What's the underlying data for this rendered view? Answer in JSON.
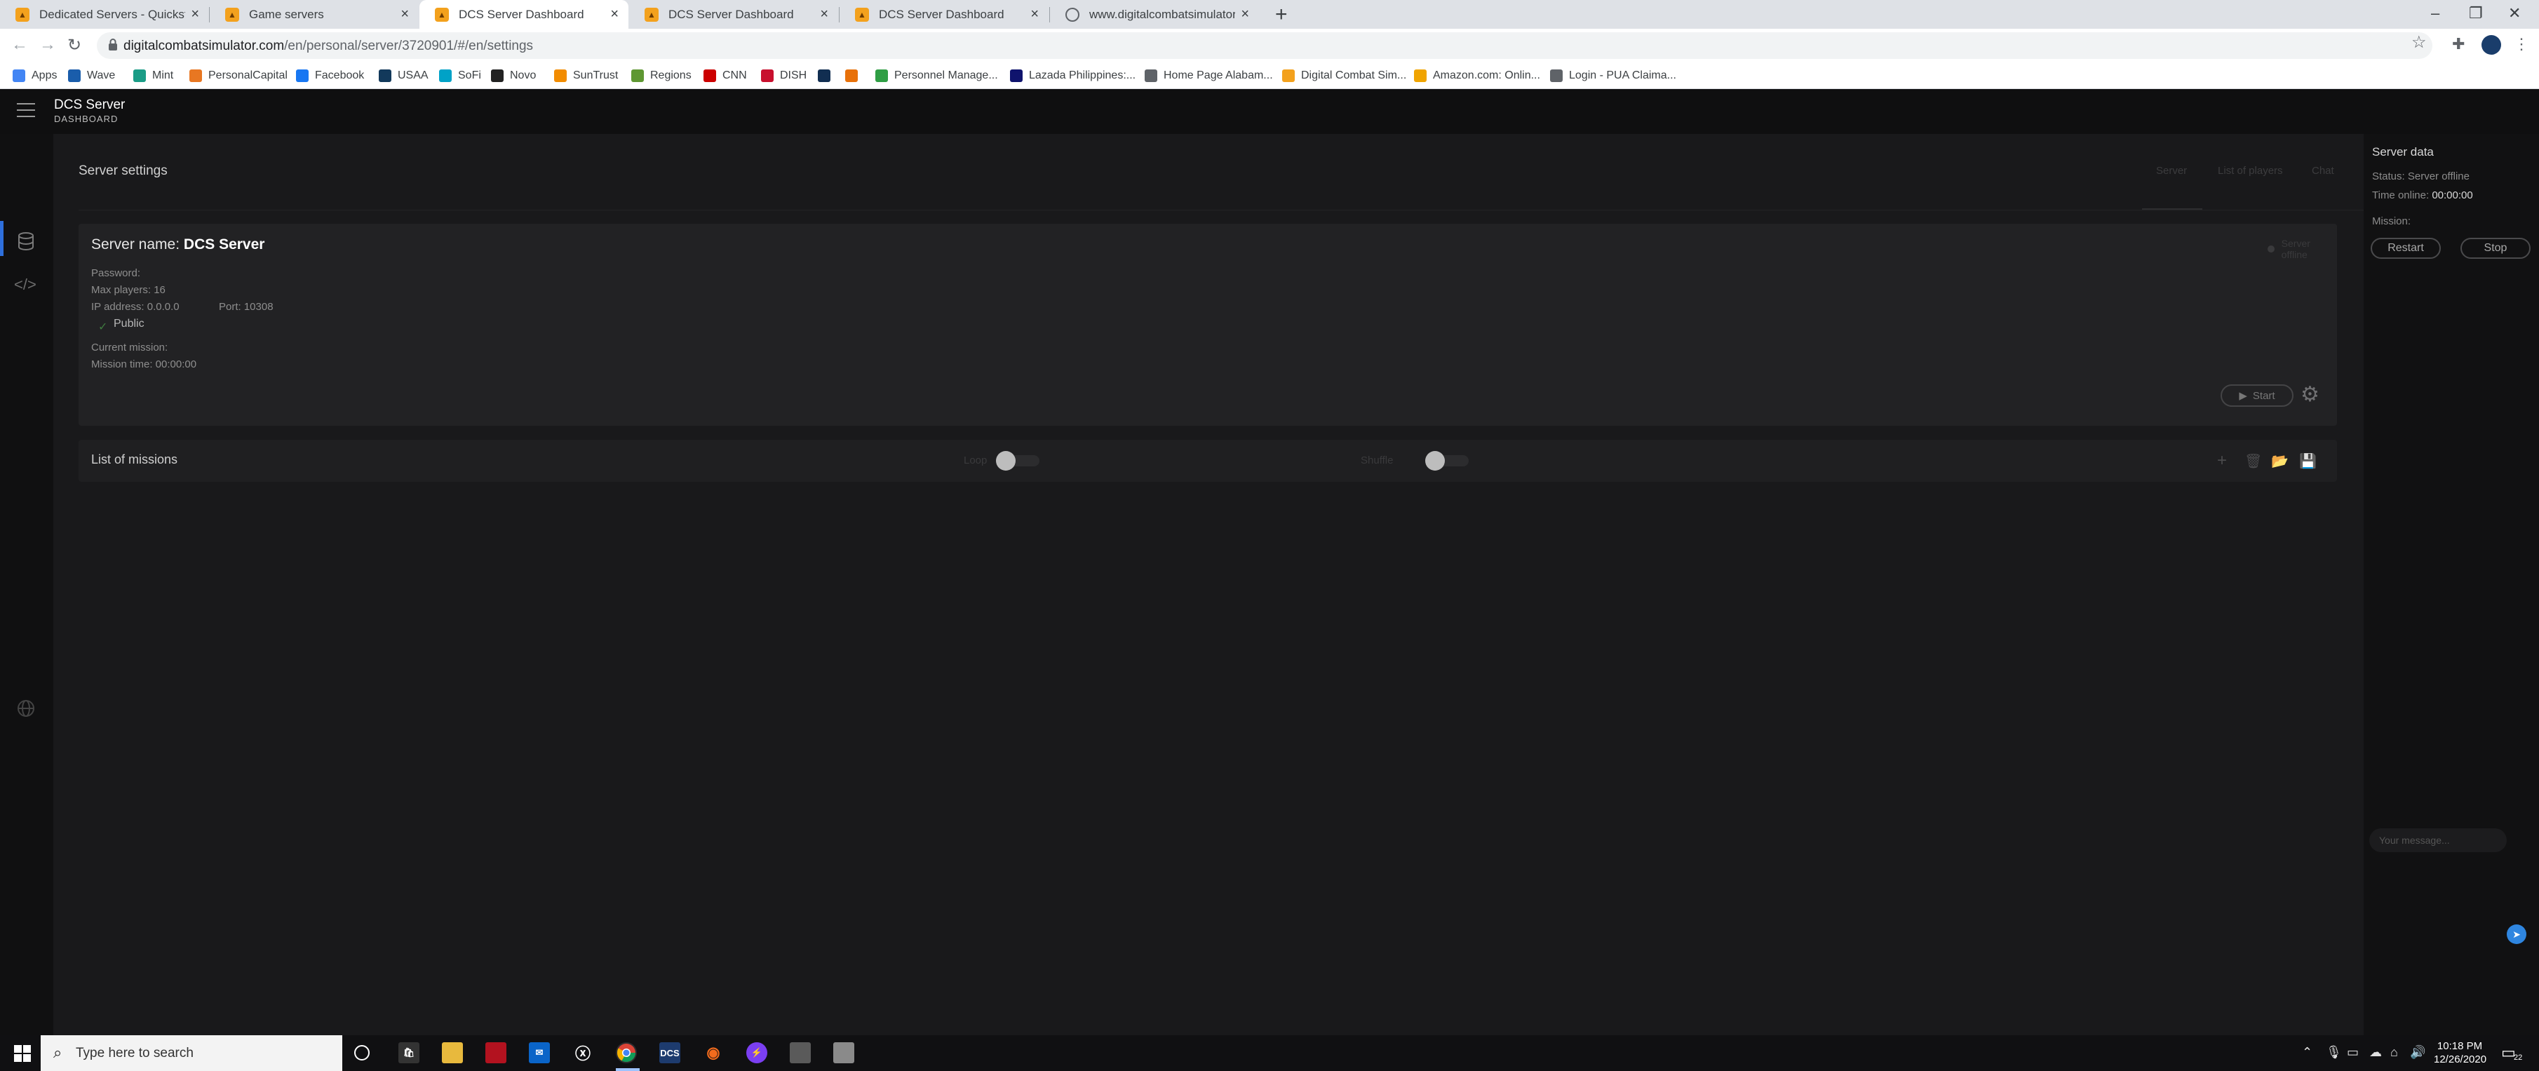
{
  "browser": {
    "tabs": [
      {
        "title": "Dedicated Servers - Quickstart - ",
        "favicon": "dcs-icon"
      },
      {
        "title": "Game servers",
        "favicon": "dcs-icon"
      },
      {
        "title": "DCS Server Dashboard",
        "favicon": "dcs-icon"
      },
      {
        "title": "DCS Server Dashboard",
        "favicon": "dcs-icon"
      },
      {
        "title": "DCS Server Dashboard",
        "favicon": "dcs-icon"
      },
      {
        "title": "www.digitalcombatsimulator.com",
        "favicon": "globe-icon"
      }
    ],
    "active_tab_index": 2,
    "url_host": "digitalcombatsimulator.com",
    "url_path": "/en/personal/server/3720901/#/en/settings"
  },
  "bookmarks": [
    {
      "label": "Apps",
      "icon": "apps-grid-icon",
      "color": "#4285f4"
    },
    {
      "label": "Wave",
      "icon": "wave-icon",
      "color": "#1a5dab"
    },
    {
      "label": "Mint",
      "icon": "mint-icon",
      "color": "#1a9c86"
    },
    {
      "label": "PersonalCapital",
      "icon": "personalcapital-icon",
      "color": "#e87722"
    },
    {
      "label": "Facebook",
      "icon": "facebook-icon",
      "color": "#1877f2"
    },
    {
      "label": "USAA",
      "icon": "usaa-icon",
      "color": "#12395b"
    },
    {
      "label": "SoFi",
      "icon": "sofi-icon",
      "color": "#00a2c7"
    },
    {
      "label": "Novo",
      "icon": "novo-icon",
      "color": "#222222"
    },
    {
      "label": "SunTrust",
      "icon": "suntrust-icon",
      "color": "#f28c00"
    },
    {
      "label": "Regions",
      "icon": "regions-icon",
      "color": "#5e9732"
    },
    {
      "label": "CNN",
      "icon": "cnn-icon",
      "color": "#cc0000"
    },
    {
      "label": "DISH",
      "icon": "dish-icon",
      "color": "#c8102e"
    },
    {
      "label": "",
      "icon": "va-icon",
      "color": "#112e51"
    },
    {
      "label": "",
      "icon": "bookmark-icon",
      "color": "#e8710a"
    },
    {
      "label": "Personnel Manage...",
      "icon": "personnel-icon",
      "color": "#2f9e44"
    },
    {
      "label": "Lazada Philippines:...",
      "icon": "lazada-icon",
      "color": "#0f136d"
    },
    {
      "label": "Home Page Alabam...",
      "icon": "page-icon",
      "color": "#5f6368"
    },
    {
      "label": "Digital Combat Sim...",
      "icon": "dcs-icon",
      "color": "#f3a11d"
    },
    {
      "label": "Amazon.com: Onlin...",
      "icon": "amazon-icon",
      "color": "#f0a400"
    },
    {
      "label": "Login - PUA Claima...",
      "icon": "page-icon",
      "color": "#5f6368"
    }
  ],
  "app": {
    "brand_title": "DCS Server",
    "brand_subtitle": "DASHBOARD",
    "page_title": "Server settings",
    "top_tabs": [
      "Server",
      "List of players",
      "Chat"
    ],
    "server": {
      "name_label": "Server name:",
      "name_value": "DCS Server",
      "password_label": "Password:",
      "max_players_label": "Max players: 16",
      "ip_label": "IP address: 0.0.0.0",
      "port_label": "Port: 10308",
      "public_label": "Public",
      "current_mission_label": "Current mission:",
      "mission_time_label": "Mission time: 00:00:00",
      "status_badge": "Server offline",
      "start_label": "Start"
    },
    "missions": {
      "title": "List of missions",
      "loop_label": "Loop",
      "shuffle_label": "Shuffle",
      "loop_on": false,
      "shuffle_on": false
    }
  },
  "server_data": {
    "title": "Server data",
    "status_text": "Status: Server offline",
    "time_online_label": "Time online:",
    "time_online_value": "00:00:00",
    "mission_label": "Mission:",
    "restart_label": "Restart",
    "stop_label": "Stop",
    "message_placeholder": "Your message..."
  },
  "taskbar": {
    "search_placeholder": "Type here to search",
    "time": "10:18 PM",
    "date": "12/26/2020",
    "notification_count": "22"
  },
  "colors": {
    "accent": "#2e6fdc",
    "send_button": "#2f86e0",
    "background": "#19191b",
    "card": "#222224"
  }
}
